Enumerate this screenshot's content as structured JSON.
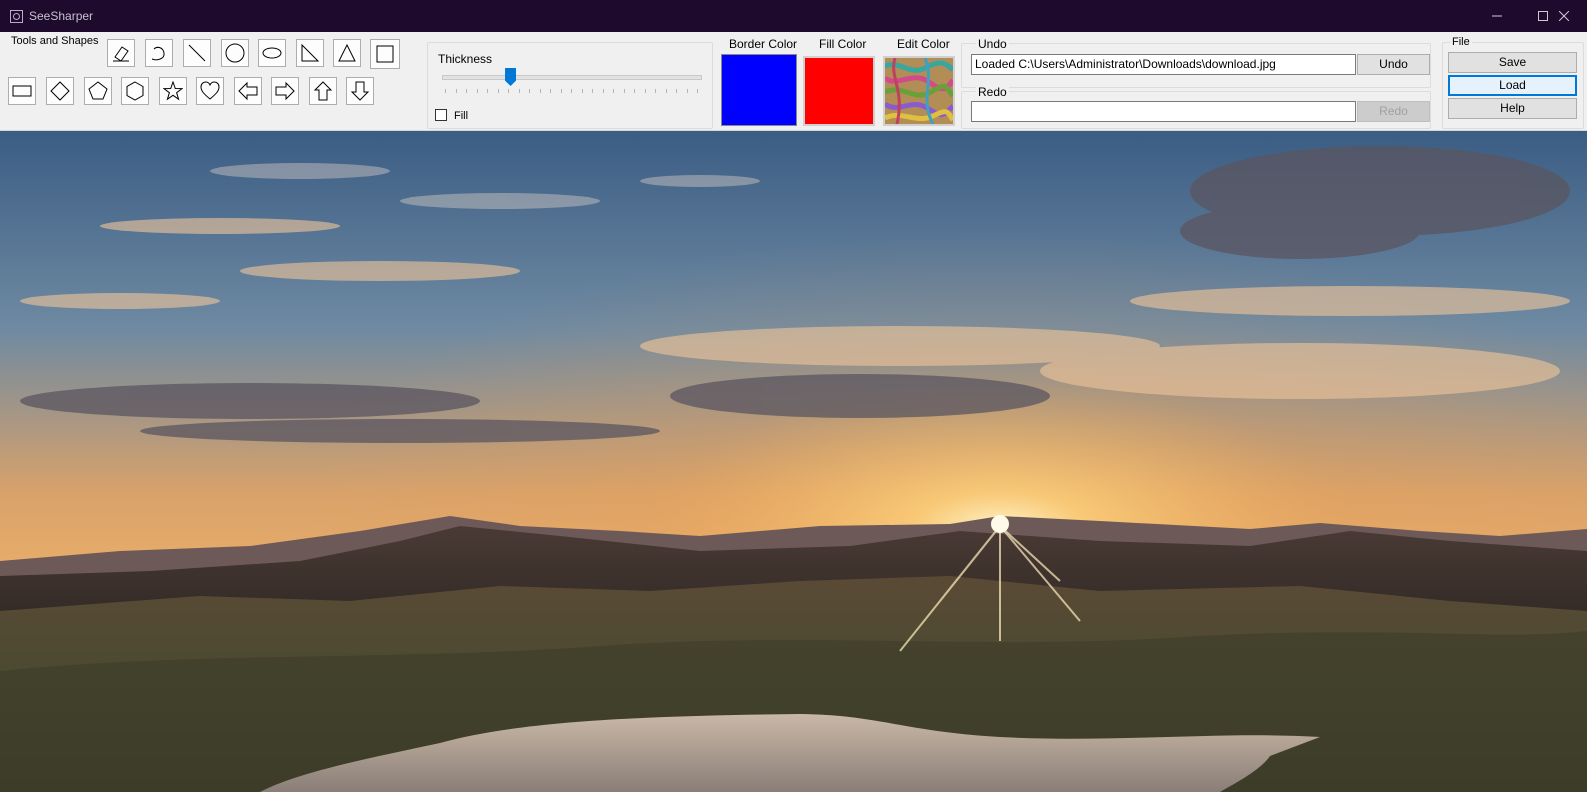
{
  "window": {
    "title": "SeeSharper",
    "controls": [
      "minimize-icon",
      "maximize-icon",
      "close-icon"
    ]
  },
  "tools": {
    "label": "Tools and Shapes",
    "items": [
      "eraser",
      "freehand",
      "line",
      "circle",
      "ellipse",
      "right-triangle",
      "triangle",
      "square",
      "rectangle",
      "diamond",
      "pentagon",
      "hexagon",
      "star",
      "heart",
      "arrow-left",
      "arrow-right",
      "arrow-up",
      "arrow-down"
    ]
  },
  "thickness": {
    "label": "Thickness",
    "value_fraction": 0.27,
    "fill_label": "Fill",
    "fill_checked": false
  },
  "colors": {
    "border_label": "Border Color",
    "border_value": "#0000ff",
    "fill_label": "Fill Color",
    "fill_value": "#ff0000",
    "edit_label": "Edit Color"
  },
  "undo": {
    "label": "Undo",
    "value": "Loaded C:\\Users\\Administrator\\Downloads\\download.jpg",
    "button": "Undo"
  },
  "redo": {
    "label": "Redo",
    "value": "",
    "button": "Redo"
  },
  "file": {
    "label": "File",
    "save": "Save",
    "load": "Load",
    "help": "Help"
  }
}
